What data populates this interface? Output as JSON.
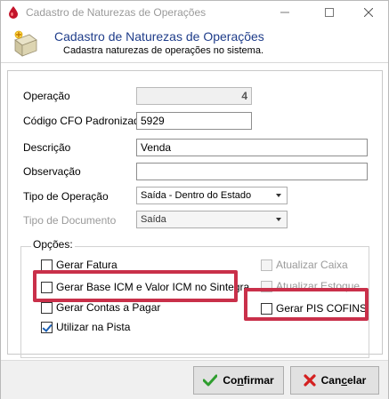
{
  "window": {
    "title": "Cadastro de Naturezas de Operações"
  },
  "header": {
    "title": "Cadastro de Naturezas de Operações",
    "subtitle": "Cadastra naturezas de operações no sistema."
  },
  "form": {
    "operacao": {
      "label": "Operação",
      "value": "4"
    },
    "cfo": {
      "label": "Código CFO Padronizado",
      "value": "5929"
    },
    "descricao": {
      "label": "Descrição",
      "value": "Venda"
    },
    "observacao": {
      "label": "Observação",
      "value": ""
    },
    "tipo_operacao": {
      "label": "Tipo de Operação",
      "value": "Saída - Dentro do Estado"
    },
    "tipo_documento": {
      "label": "Tipo de Documento",
      "value": "Saída"
    }
  },
  "options": {
    "title": "Opções:",
    "items": [
      {
        "label": "Gerar Fatura",
        "checked": false,
        "enabled": true
      },
      {
        "label": "Gerar Base ICM e Valor ICM no Sintegra",
        "checked": false,
        "enabled": true
      },
      {
        "label": "Gerar Contas a Pagar",
        "checked": false,
        "enabled": true
      },
      {
        "label": "Utilizar na Pista",
        "checked": true,
        "enabled": true
      },
      {
        "label": "Atualizar Caixa",
        "checked": false,
        "enabled": false
      },
      {
        "label": "Atualizar Estoque",
        "checked": false,
        "enabled": false
      },
      {
        "label": "Gerar PIS COFINS",
        "checked": false,
        "enabled": true
      }
    ]
  },
  "buttons": {
    "confirmar_prefix": "Co",
    "confirmar_accel": "n",
    "confirmar_suffix": "firmar",
    "cancelar_prefix": "Can",
    "cancelar_accel": "c",
    "cancelar_suffix": "elar"
  },
  "colors": {
    "highlight": "#c9304a",
    "header_title": "#1f3d8a"
  }
}
